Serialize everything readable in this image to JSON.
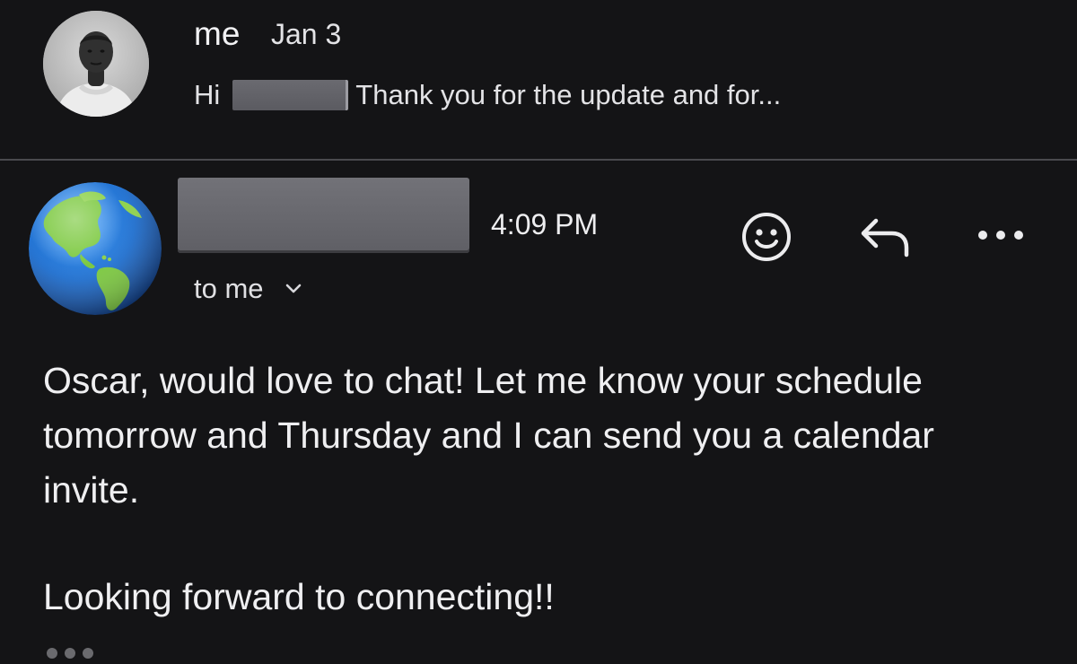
{
  "previous_message": {
    "sender": "me",
    "date": "Jan 3",
    "snippet_greeting": "Hi",
    "snippet_text": "Thank you for the update and for..."
  },
  "message": {
    "time": "4:09 PM",
    "recipient_label": "to me",
    "body": [
      "Oscar, would love to chat! Let me know your schedule tomorrow and Thursday and I can send you a calendar invite.",
      "Looking forward to connecting!!"
    ]
  },
  "icons": {
    "emoji_reaction": "smiley-face-icon",
    "reply": "reply-arrow-icon",
    "more": "more-horizontal-icon",
    "recipient_toggle": "chevron-down-icon"
  }
}
